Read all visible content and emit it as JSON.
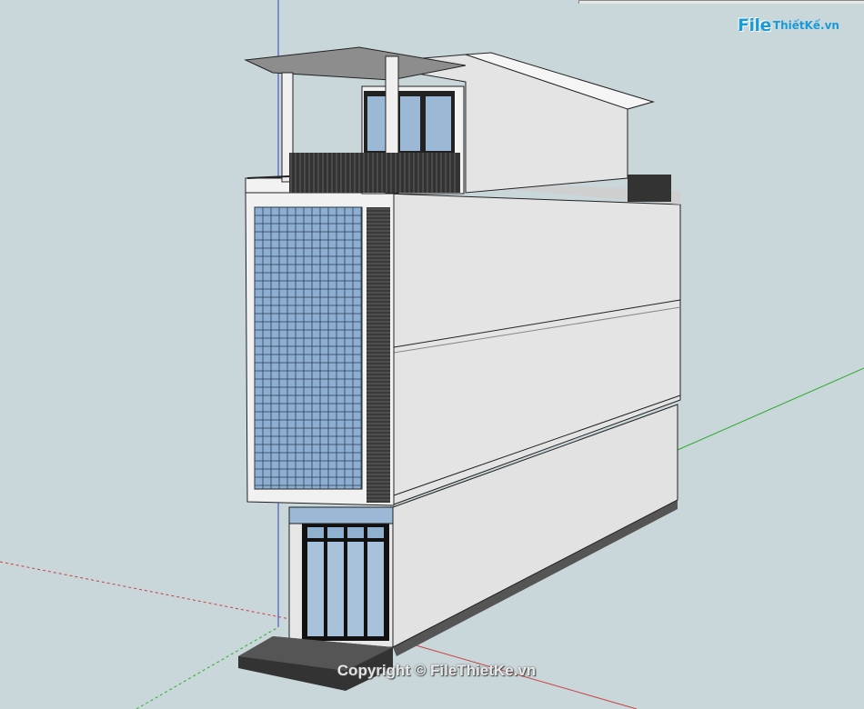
{
  "watermark": {
    "logo_file": "File",
    "logo_rest": "ThiếtKế.vn",
    "copyright": "Copyright © FileThietKe.vn"
  },
  "colors": {
    "background": "#c9d7da",
    "wall": "#e4e4e4",
    "wall_side": "#d8d8d8",
    "glass": "#9bb8d6",
    "louver": "#2e2e2e",
    "axis_red": "#c94040",
    "axis_green": "#2faa2f",
    "axis_blue": "#3040c0",
    "logo_blue": "#1a9bd7"
  }
}
